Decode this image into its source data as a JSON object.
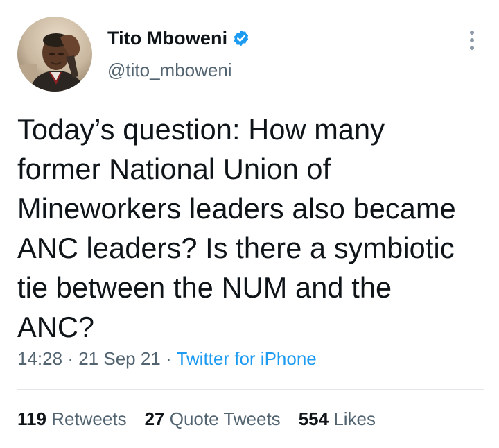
{
  "author": {
    "display_name": "Tito Mboweni",
    "handle": "@tito_mboweni",
    "verified": true,
    "avatar_icon": "profile-photo"
  },
  "tweet": {
    "text": "Today’s question: How many\nformer National Union of\nMineworkers leaders also became\nANC leaders? Is there a symbiotic\ntie between the NUM and the\nANC?",
    "time": "14:28",
    "separator": "·",
    "date": "21 Sep 21",
    "source": "Twitter for iPhone"
  },
  "stats": {
    "retweets_count": "119",
    "retweets_label": "Retweets",
    "quotes_count": "27",
    "quotes_label": "Quote Tweets",
    "likes_count": "554",
    "likes_label": "Likes"
  },
  "colors": {
    "accent": "#1d9bf0",
    "text_primary": "#0f1419",
    "text_secondary": "#536471"
  }
}
